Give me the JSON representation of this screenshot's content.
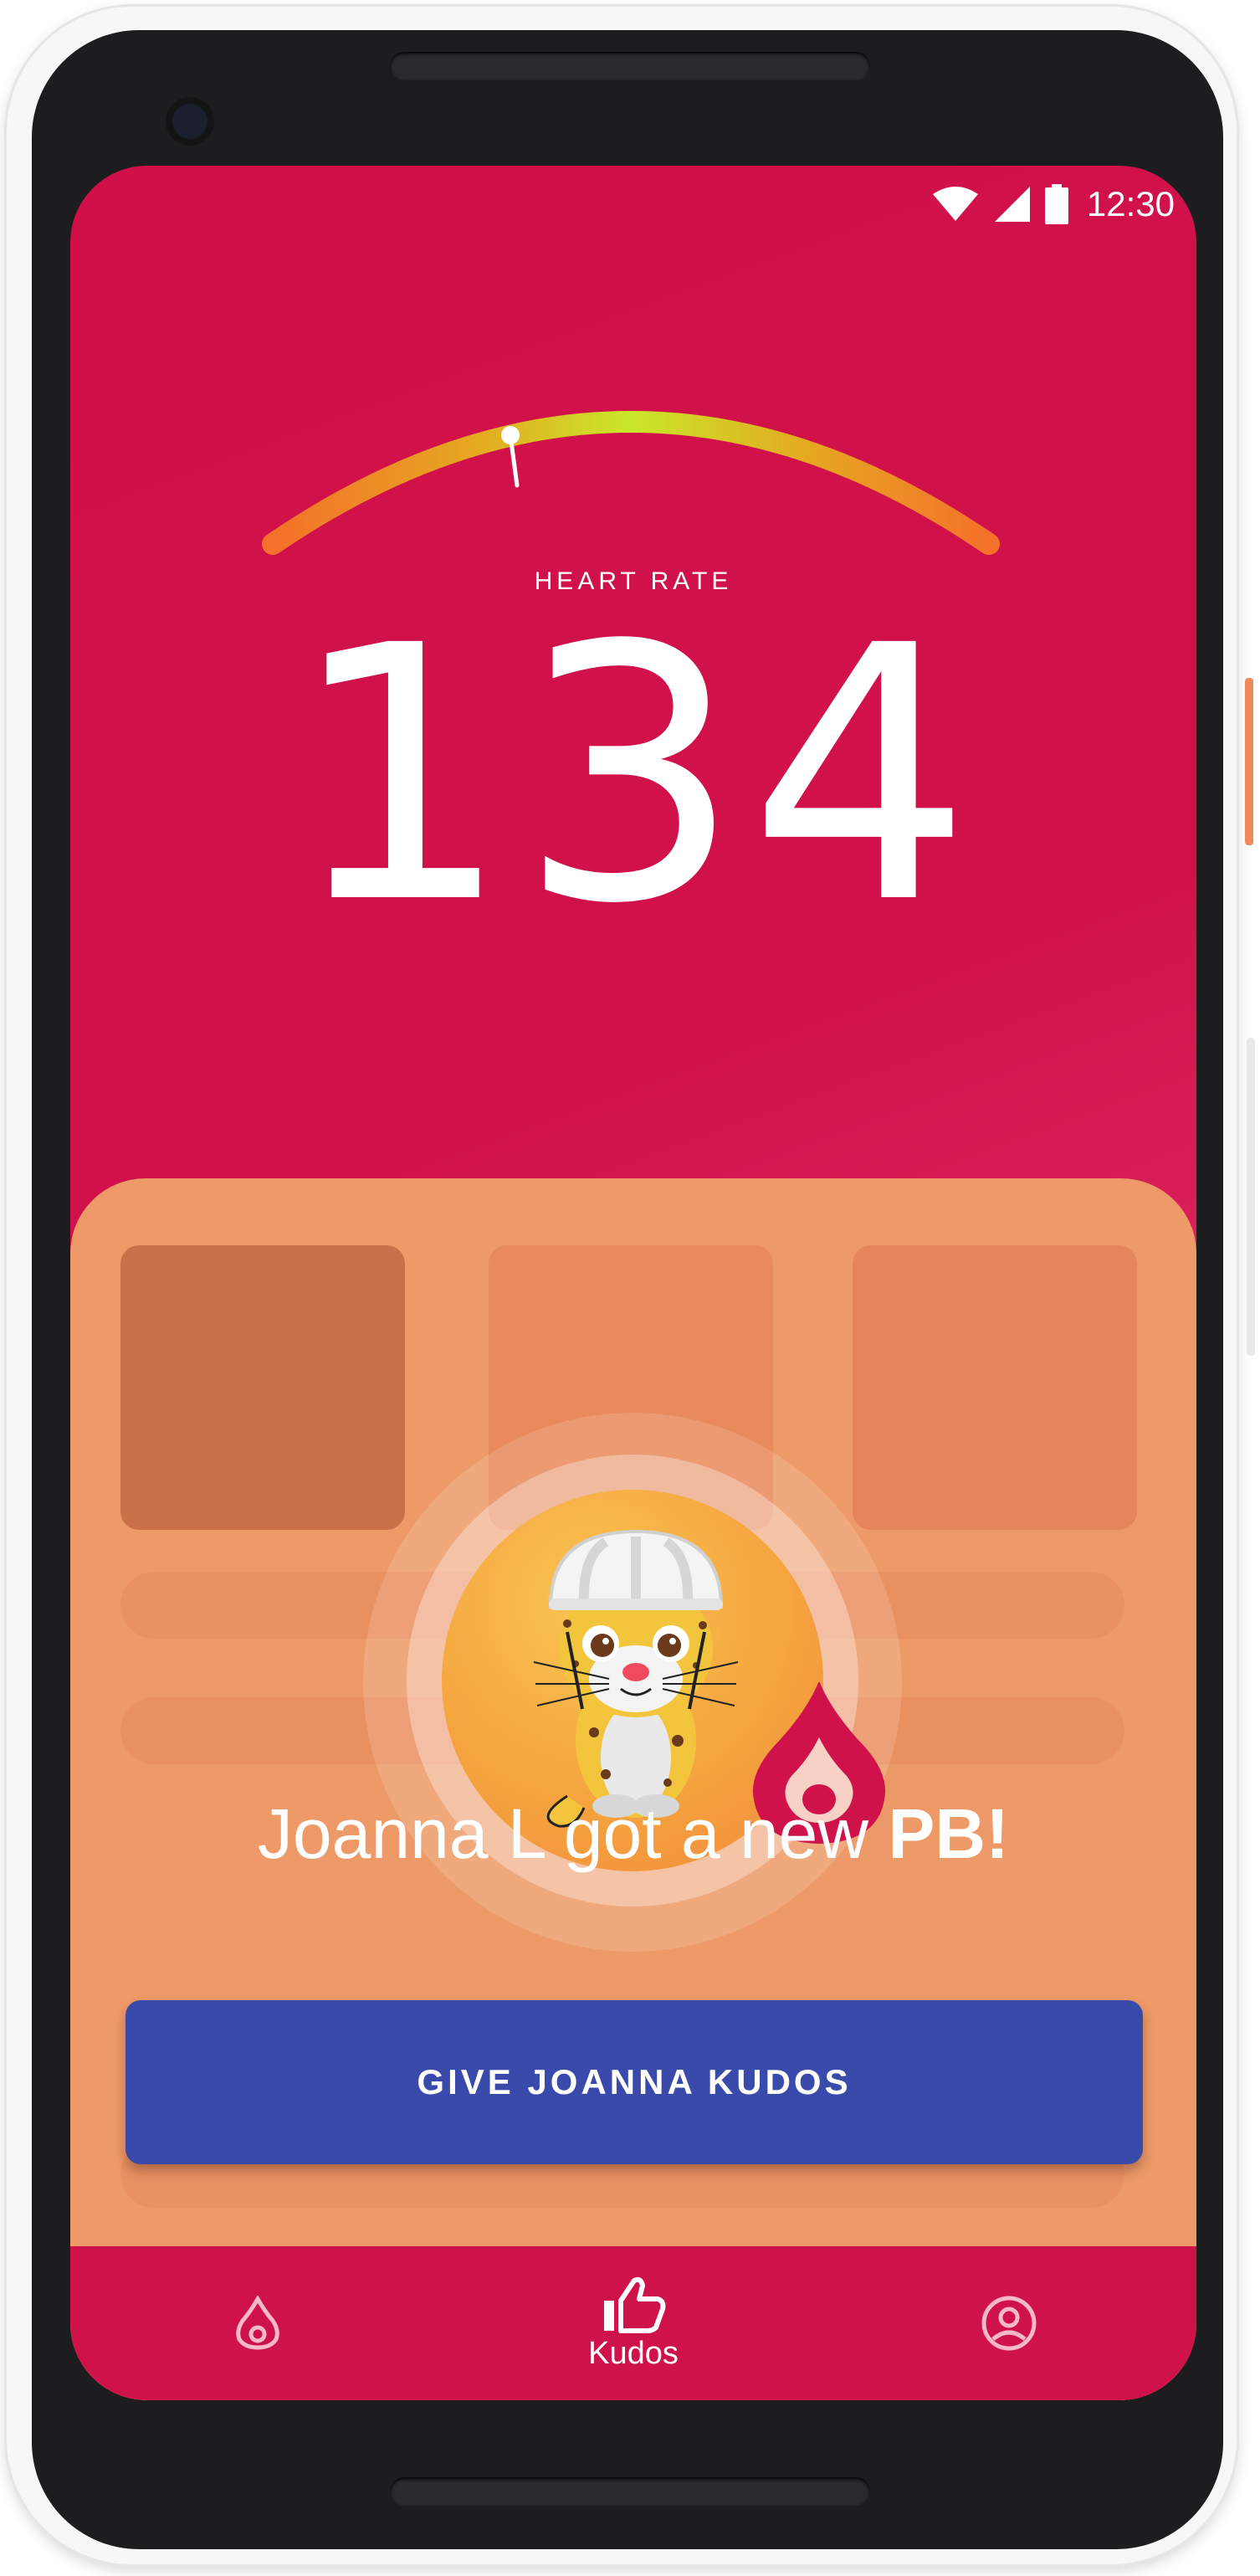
{
  "status_bar": {
    "time": "12:30",
    "icons": [
      "wifi-icon",
      "cellular-signal-icon",
      "battery-icon"
    ]
  },
  "heart_rate": {
    "label": "HEART RATE",
    "value": "134",
    "gauge_position": 0.35
  },
  "notification": {
    "message_prefix": "Joanna L got a new ",
    "message_emphasis": "PB!",
    "avatar": "cheetah-cyclist-avatar",
    "badge": "flame-badge-icon"
  },
  "action": {
    "label": "GIVE JOANNA KUDOS"
  },
  "bottom_nav": {
    "items": [
      {
        "icon": "flame-icon",
        "label": ""
      },
      {
        "icon": "thumbs-up-icon",
        "label": "Kudos",
        "active": true
      },
      {
        "icon": "profile-icon",
        "label": ""
      }
    ]
  },
  "colors": {
    "primary": "#d1104a",
    "sheet": "#ee9a68",
    "button": "#3a4aab",
    "gauge_start": "#f5702a",
    "gauge_peak": "#c9e72a"
  }
}
